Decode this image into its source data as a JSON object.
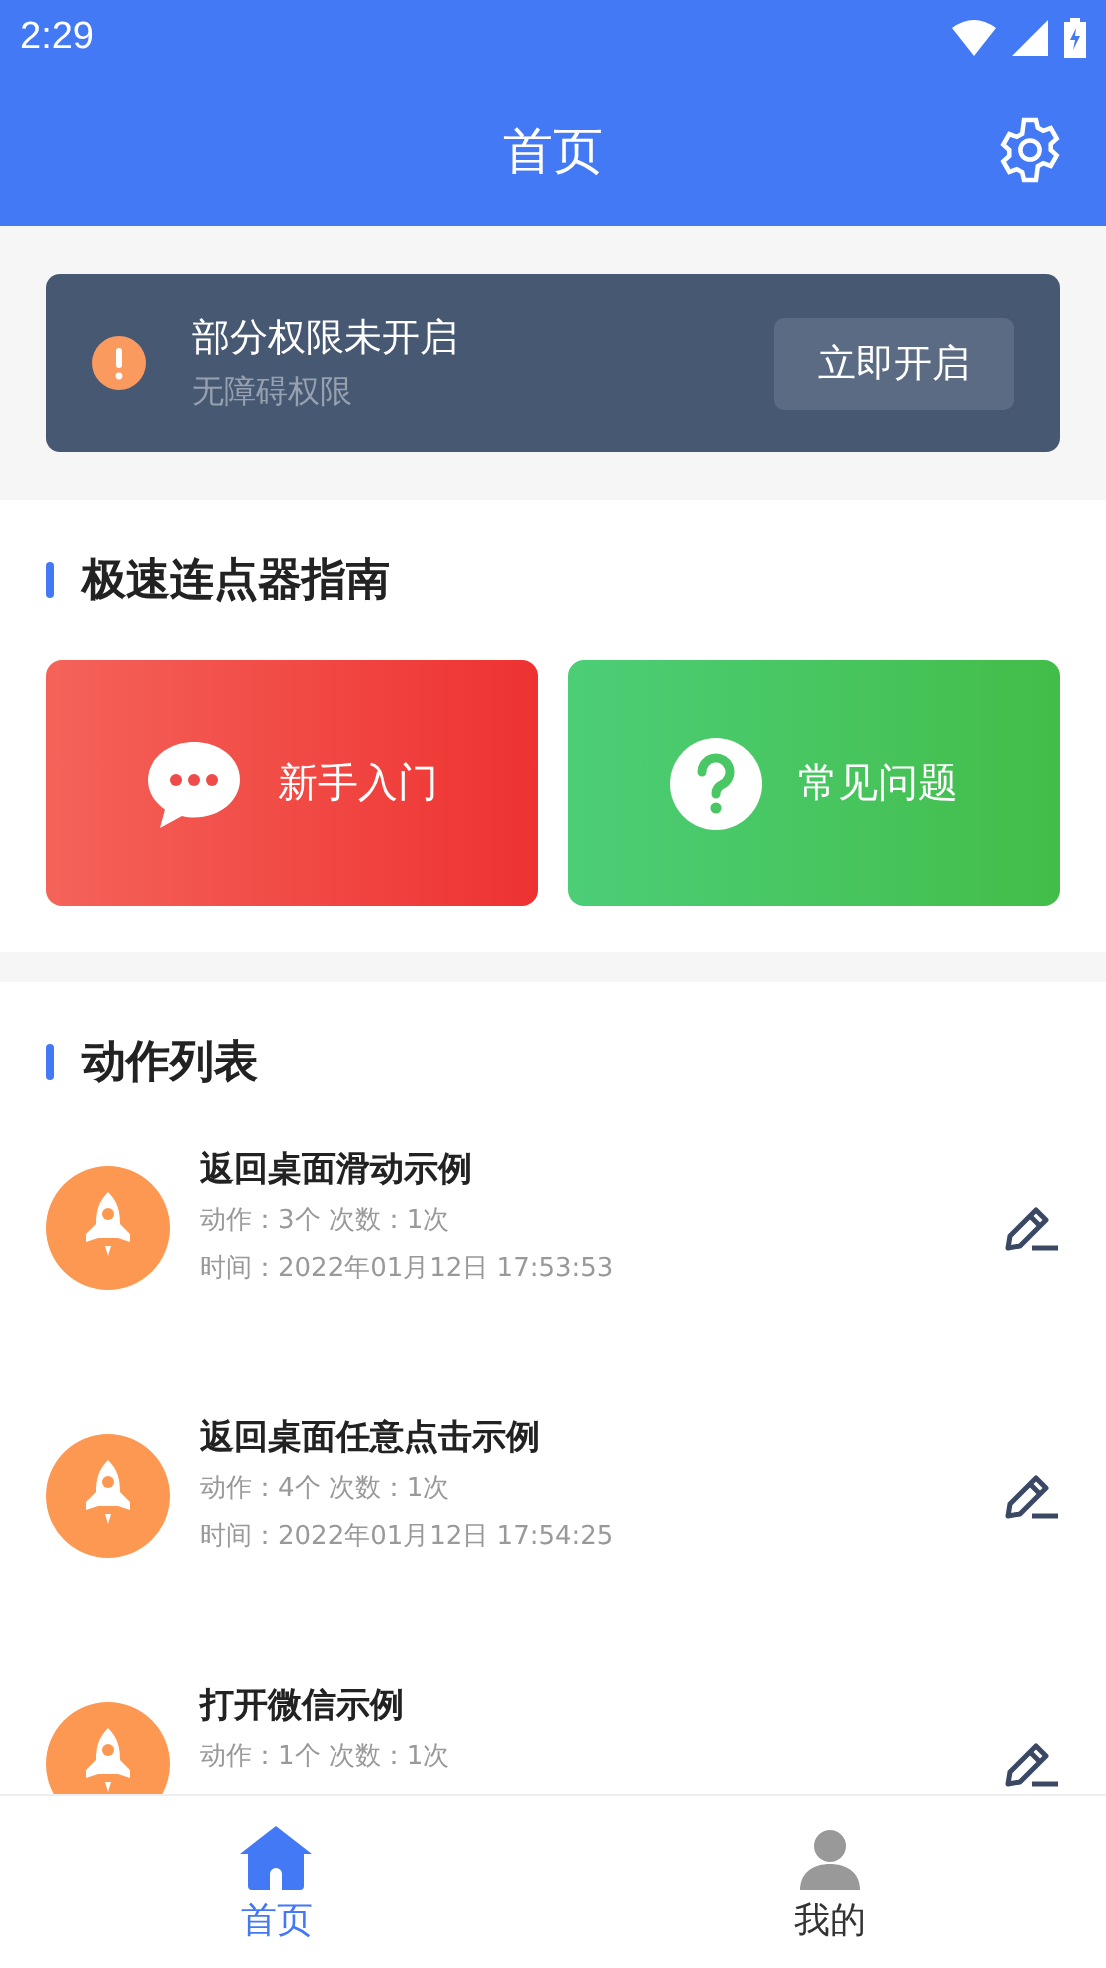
{
  "status_bar": {
    "time": "2:29"
  },
  "app_bar": {
    "title": "首页"
  },
  "permission_banner": {
    "title": "部分权限未开启",
    "subtitle": "无障碍权限",
    "button": "立即开启"
  },
  "guide": {
    "title": "极速连点器指南",
    "cards": [
      {
        "label": "新手入门",
        "kind": "chat"
      },
      {
        "label": "常见问题",
        "kind": "question"
      }
    ]
  },
  "actions": {
    "title": "动作列表",
    "items": [
      {
        "name": "返回桌面滑动示例",
        "details": [
          "动作：3个 次数：1次",
          "时间：2022年01月12日 17:53:53"
        ]
      },
      {
        "name": "返回桌面任意点击示例",
        "details": [
          "动作：4个 次数：1次",
          "时间：2022年01月12日 17:54:25"
        ]
      },
      {
        "name": "打开微信示例",
        "details": [
          "动作：1个 次数：1次"
        ]
      }
    ]
  },
  "bottom_nav": [
    {
      "label": "首页",
      "kind": "home",
      "selected": true
    },
    {
      "label": "我的",
      "kind": "person",
      "selected": false
    }
  ]
}
